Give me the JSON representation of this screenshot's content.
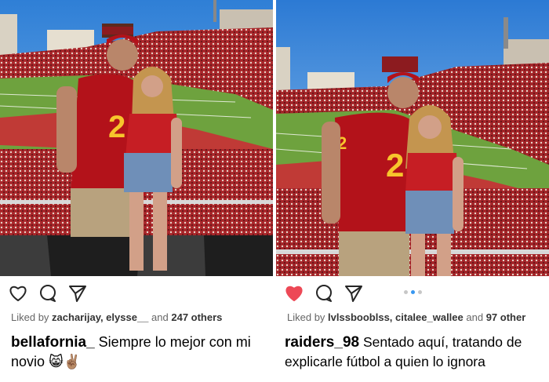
{
  "posts": [
    {
      "liked": false,
      "likes": {
        "prefix": "Liked by",
        "users": "zacharijay, elysse__",
        "conj": "and",
        "others": "247 others"
      },
      "caption": {
        "username": "bellafornia_",
        "text": "Siempre lo mejor con mi novio 😸✌🏽"
      },
      "icons": [
        "heart-outline-icon",
        "comment-icon",
        "share-icon"
      ],
      "jersey_number": "2"
    },
    {
      "liked": true,
      "likes": {
        "prefix": "Liked by",
        "users": "lvlssbooblss, citalee_wallee",
        "conj": "and",
        "others": "97 other"
      },
      "caption": {
        "username": "raiders_98",
        "text": "Sentado aquí, tratando de explicarle fútbol a quien lo ignora"
      },
      "icons": [
        "heart-filled-icon",
        "comment-icon",
        "share-icon"
      ],
      "carousel": {
        "count": 3,
        "active": 2
      },
      "jersey_number": "2"
    }
  ],
  "colors": {
    "heart_red": "#ed4956",
    "carousel_active": "#3897f0",
    "jersey": "#b3121a",
    "jersey_trim": "#f7c52c",
    "sky": "#3b8fe0",
    "field": "#6ea23e"
  }
}
